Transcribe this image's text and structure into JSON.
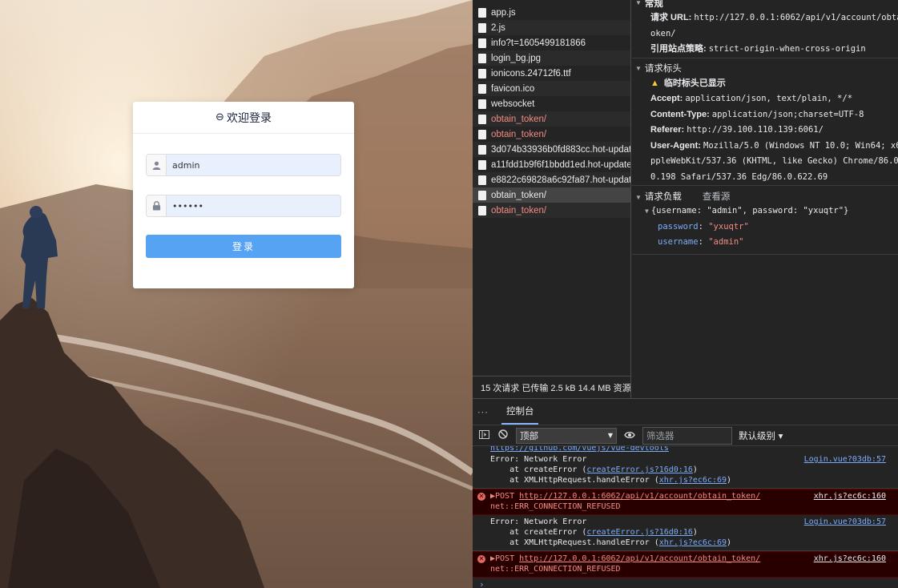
{
  "login": {
    "title": "欢迎登录",
    "username": "admin",
    "password_masked": "••••••",
    "button": "登录"
  },
  "network": {
    "requests": [
      {
        "name": "app.js",
        "error": false
      },
      {
        "name": "2.js",
        "error": false
      },
      {
        "name": "info?t=1605499181866",
        "error": false
      },
      {
        "name": "login_bg.jpg",
        "error": false
      },
      {
        "name": "ionicons.24712f6.ttf",
        "error": false
      },
      {
        "name": "favicon.ico",
        "error": false
      },
      {
        "name": "websocket",
        "error": false
      },
      {
        "name": "obtain_token/",
        "error": true
      },
      {
        "name": "obtain_token/",
        "error": true
      },
      {
        "name": "3d074b33936b0fd883cc.hot-update.json",
        "error": false
      },
      {
        "name": "a11fdd1b9f6f1bbdd1ed.hot-update.json",
        "error": false
      },
      {
        "name": "e8822c69828a6c92fa87.hot-update.json",
        "error": false
      },
      {
        "name": "obtain_token/",
        "error": false,
        "selected": true
      },
      {
        "name": "obtain_token/",
        "error": true
      }
    ],
    "summary": "15 次请求  已传输 2.5 kB  14.4 MB 资源"
  },
  "headers": {
    "general_title": "常规",
    "request_url_label": "请求 URL:",
    "request_url_1": "http://127.0.0.1:6062/api/v1/account/obtai",
    "request_url_2": "oken/",
    "referrer_policy_label": "引用站点策略:",
    "referrer_policy": "strict-origin-when-cross-origin",
    "req_headers_title": "请求标头",
    "provisional": "临时标头已显示",
    "accept_label": "Accept:",
    "accept": "application/json, text/plain, */*",
    "content_type_label": "Content-Type:",
    "content_type": "application/json;charset=UTF-8",
    "referer_label": "Referer:",
    "referer": "http://39.100.110.139:6061/",
    "ua_label": "User-Agent:",
    "ua_1": "Mozilla/5.0 (Windows NT 10.0; Win64; x64",
    "ua_2": "ppleWebKit/537.36 (KHTML, like Gecko) Chrome/86.0.4",
    "ua_3": "0.198 Safari/537.36 Edg/86.0.622.69",
    "payload_title": "请求负载",
    "view_source": "查看源",
    "payload_summary": "{username: \"admin\", password: \"yxuqtr\"}",
    "password_key": "password",
    "password_val": "\"yxuqtr\"",
    "username_key": "username",
    "username_val": "\"admin\""
  },
  "console": {
    "dots": "···",
    "tab": "控制台",
    "context": "顶部",
    "filter_placeholder": "筛选器",
    "levels": "默认级别 ▾",
    "partial_line": "https://github.com/vuejs/vue-devtools",
    "msg1_line1": "Error: Network Error",
    "msg1_line2": "    at createError (",
    "msg1_link2": "createError.js?16d0:16",
    "msg1_line3": "    at XMLHttpRequest.handleError (",
    "msg1_link3": "xhr.js?ec6c:69",
    "msg1_src": "Login.vue?03db:57",
    "err1_prefix": "▶POST ",
    "err1_url": "http://127.0.0.1:6062/api/v1/account/obtain_token/",
    "err1_line2": "net::ERR_CONNECTION_REFUSED",
    "err1_src": "xhr.js?ec6c:160",
    "msg2_line1": "Error: Network Error",
    "msg2_line2": "    at createError (",
    "msg2_link2": "createError.js?16d0:16",
    "msg2_line3": "    at XMLHttpRequest.handleError (",
    "msg2_link3": "xhr.js?ec6c:69",
    "msg2_src": "Login.vue?03db:57",
    "err2_prefix": "▶POST ",
    "err2_url": "http://127.0.0.1:6062/api/v1/account/obtain_token/",
    "err2_line2": "net::ERR_CONNECTION_REFUSED",
    "err2_src": "xhr.js?ec6c:160",
    "prompt": "›"
  }
}
